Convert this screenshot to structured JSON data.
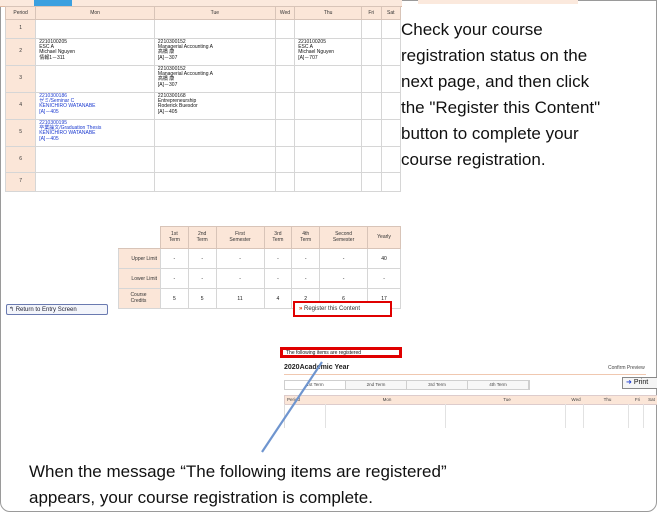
{
  "timetable": {
    "headers": [
      "Period",
      "Mon",
      "Tue",
      "Wed",
      "Thu",
      "Fri",
      "Sat"
    ],
    "rows": [
      {
        "period": "1",
        "mon": [],
        "tue": [],
        "thu": []
      },
      {
        "period": "2",
        "mon": [
          "2210100205",
          "ESC A",
          "Michael Nguyen",
          "情報1－311"
        ],
        "tue": [
          "2210300152",
          "Managerial Accounting A",
          "高橋 康",
          "[A]－307"
        ],
        "thu": [
          "2210100205",
          "ESC A",
          "Michael Nguyen",
          "[A]－707"
        ]
      },
      {
        "period": "3",
        "mon": [],
        "tue": [
          "2210300152",
          "Managerial Accounting A",
          "高橋 康",
          "[A]－307"
        ],
        "thu": []
      },
      {
        "period": "4",
        "mon": [
          "2210300186",
          "ゼミ/Seminar C",
          "KENICHIRO WATANABE",
          "[A]－405"
        ],
        "tue": [
          "2210300168",
          "Entrepreneurship",
          "Roderick Buesdor",
          "[A]－405"
        ],
        "thu": []
      },
      {
        "period": "5",
        "mon": [
          "2210300195",
          "卒業論文/Graduation Thesis",
          "KENICHIRO WATANABE",
          "[A]－405"
        ],
        "tue": [],
        "thu": []
      },
      {
        "period": "6",
        "mon": [],
        "tue": [],
        "thu": []
      },
      {
        "period": "7",
        "mon": [],
        "tue": [],
        "thu": []
      }
    ]
  },
  "credits": {
    "headers": [
      [
        "1st",
        "Term"
      ],
      [
        "2nd",
        "Term"
      ],
      [
        "First",
        "Semester"
      ],
      [
        "3rd",
        "Term"
      ],
      [
        "4th",
        "Term"
      ],
      [
        "Second",
        "Semester"
      ],
      [
        "Yearly",
        ""
      ]
    ],
    "rows": [
      {
        "label": "Upper Limit",
        "values": [
          "-",
          "-",
          "-",
          "-",
          "-",
          "-",
          "40"
        ]
      },
      {
        "label": "Lower Limit",
        "values": [
          "-",
          "-",
          "-",
          "-",
          "-",
          "-",
          "-"
        ]
      },
      {
        "label": [
          "Course",
          "Credits"
        ],
        "values": [
          "5",
          "5",
          "11",
          "4",
          "2",
          "6",
          "17"
        ]
      }
    ]
  },
  "buttons": {
    "return_label": "Return to Entry Screen",
    "register_label": "Register this Content",
    "print_label": "Print"
  },
  "instructions": {
    "lines": [
      "Check your course",
      "registration status on the",
      "next page, and then click",
      "the \"Register this Content\"",
      "button to complete your",
      "course registration."
    ]
  },
  "preview": {
    "message": "The following items are registered",
    "year": "2020Academic Year",
    "confirm": "Confirm Preview",
    "tabs": [
      "1st Term",
      "2nd Term",
      "3rd Term",
      "4th Term"
    ],
    "headers": [
      "Period",
      "Mon",
      "Tue",
      "Wed",
      "Thu",
      "Fri",
      "Sat"
    ]
  },
  "bottom_note": {
    "line1": "When the message “The following items are registered”",
    "line2": "appears, your course registration is complete."
  },
  "colors": {
    "accent_red": "#e00000",
    "header_bg": "#fbe6d8",
    "link_blue": "#1c3bd0"
  }
}
